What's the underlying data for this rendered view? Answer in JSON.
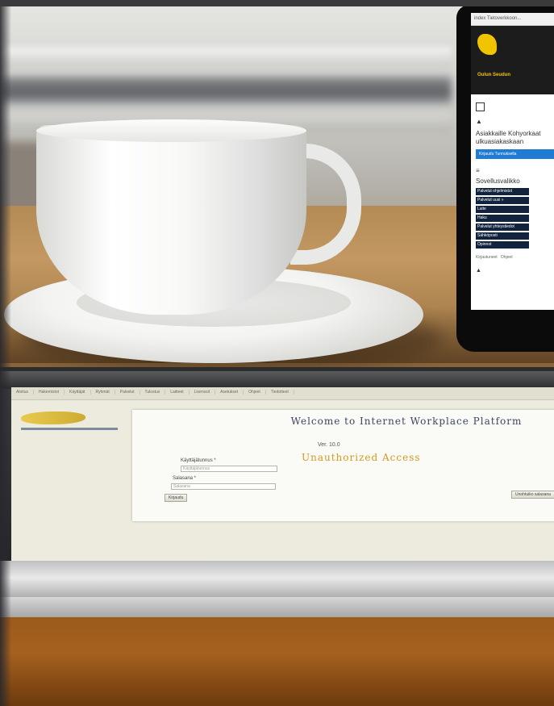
{
  "phone": {
    "url_text": "index Tietoverkkoon...",
    "brand": "Oulun Seudun",
    "title_line1": "Asiakkaille Kohyorkaat",
    "title_line2": "ulkuasiakaskaan",
    "blue_button": "Kirjaudu Tunnuksella",
    "section_title": "Sovellusvalikko",
    "menu_items": [
      "Palvelut ohjelmistot",
      "Palvelut uusi »",
      "Laite",
      "Haku",
      "Palvelut yhteystiedot",
      "Sähköposti",
      "Opinnot"
    ],
    "footer_left": "Kirjautuneet",
    "footer_right": "Ohjeet"
  },
  "tablet": {
    "tabs": [
      "Aloitus",
      "Hakemistot",
      "Käyttäjät",
      "Ryhmät",
      "Palvelut",
      "Tulostus",
      "Laitteet",
      "Lisenssit",
      "Asetukset",
      "Ohjeet",
      "Tiedotteet"
    ],
    "heading": "Welcome to Internet Workplace Platform",
    "subheading": "Ver. 10.0",
    "warning": "Unauthorized Access",
    "username_label": "Käyttäjätunnus *",
    "username_placeholder": "Käyttäjätunnus",
    "password_label": "Salasana *",
    "password_placeholder": "Salasana",
    "login_button": "Kirjaudu",
    "forgot_button": "Unohtuiko salasana"
  }
}
